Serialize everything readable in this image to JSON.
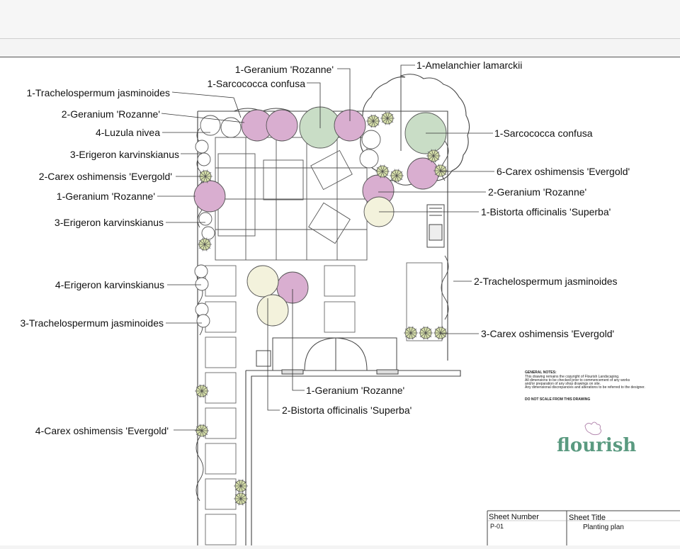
{
  "labels_left": [
    "1-Trachelospermum jasminoides",
    "2-Geranium 'Rozanne'",
    "4-Luzula nivea",
    "3-Erigeron karvinskianus",
    "2-Carex oshimensis 'Evergold'",
    "1-Geranium 'Rozanne'",
    "3-Erigeron karvinskianus",
    "4-Erigeron karvinskianus",
    "3-Trachelospermum jasminoides",
    "4-Carex oshimensis 'Evergold'"
  ],
  "labels_top": [
    "1-Geranium 'Rozanne'",
    "1-Sarcococca confusa",
    "1-Amelanchier lamarckii"
  ],
  "labels_right": [
    "1-Sarcococca confusa",
    "6-Carex oshimensis 'Evergold'",
    "2-Geranium 'Rozanne'",
    "1-Bistorta officinalis 'Superba'",
    "2-Trachelospermum jasminoides",
    "3-Carex oshimensis 'Evergold'"
  ],
  "labels_bottom": [
    "1-Geranium 'Rozanne'",
    "2-Bistorta officinalis 'Superba'"
  ],
  "notes": {
    "heading": "GENERAL NOTES:",
    "lines": [
      "This drawing remains the copyright of Flourish Landscaping.",
      "All dimensions to be checked prior to commencement of any works",
      "and/or preparation of any shop drawings on site.",
      "Any dimensional discrepancies and alterations to be referred to the designer."
    ],
    "warning": "DO NOT SCALE FROM THIS DRAWING"
  },
  "logo_text": "flourish",
  "title_block": {
    "sheet_number_label": "Sheet Number",
    "sheet_number": "P-01",
    "sheet_title_label": "Sheet Title",
    "sheet_title": "Planting plan"
  },
  "colors": {
    "geranium": "#d9aed0",
    "sarcococca": "#c9ddc6",
    "bistorta": "#f3f2dc",
    "carex": "#d6dfaa",
    "logo": "#5a9a80"
  }
}
